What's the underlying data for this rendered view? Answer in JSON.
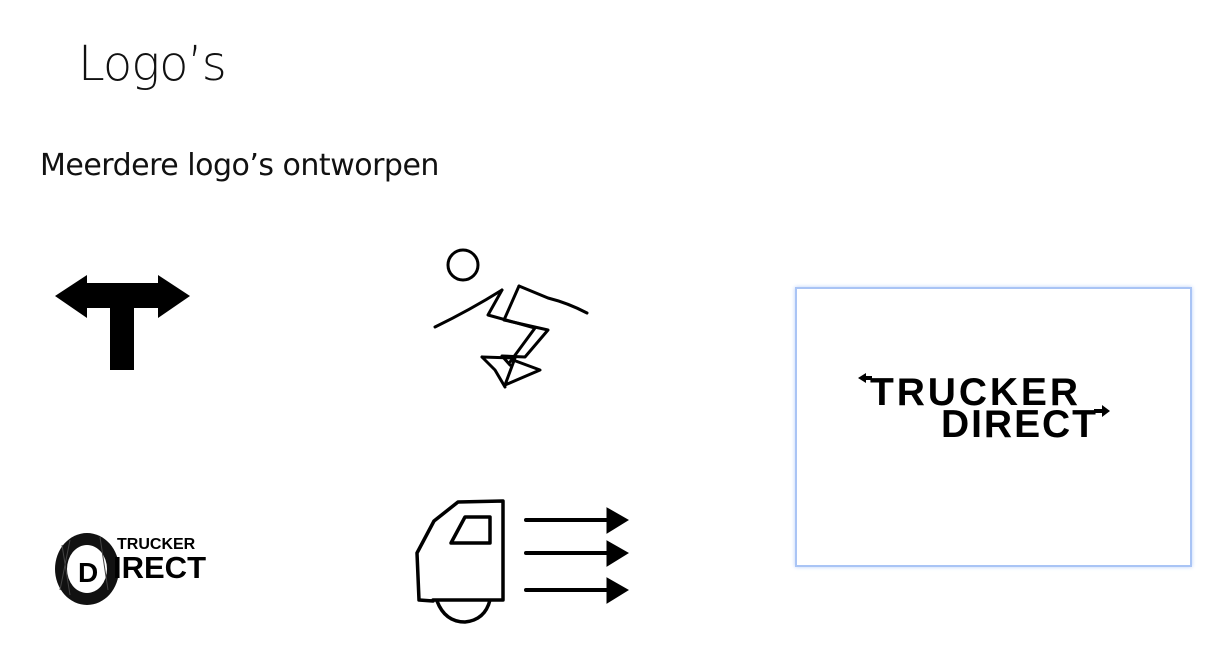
{
  "slide": {
    "title": "Logo’s",
    "subtitle": "Meerdere logo’s ontworpen"
  },
  "logos": [
    {
      "name": "t-junction-arrows",
      "text": ""
    },
    {
      "name": "running-figure-arrow",
      "text": ""
    },
    {
      "name": "tire-trucker-direct",
      "line1": "TRUCKER",
      "line2_initial": "D",
      "line2_rest": "IRECT"
    },
    {
      "name": "truck-cab-arrows",
      "text": ""
    },
    {
      "name": "trucker-direct-arrows",
      "line1": "TRUCKER",
      "line2": "DIRECT",
      "selected": true
    }
  ],
  "colors": {
    "ink": "#000000",
    "selection_border": "#a9c4f5"
  }
}
